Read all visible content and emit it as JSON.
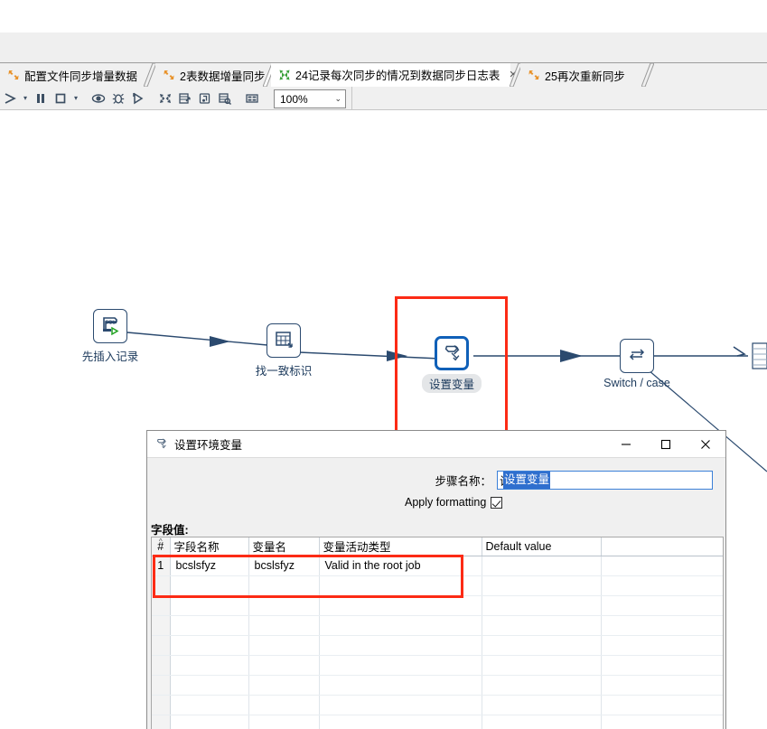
{
  "window": {
    "app_background": "#ffffff",
    "menu_band_color": "#efefef"
  },
  "tabs": [
    {
      "label": "配置文件同步增量数据",
      "icon": "job-sync-icon",
      "icon_color": "#e8922a",
      "active": false,
      "closable": false
    },
    {
      "label": "2表数据增量同步",
      "icon": "job-sync-icon",
      "icon_color": "#e8922a",
      "active": false,
      "closable": false
    },
    {
      "label": "24记录每次同步的情况到数据同步日志表",
      "icon": "transformation-icon",
      "icon_color": "#3aa03a",
      "active": true,
      "closable": true,
      "close_label": "✕"
    },
    {
      "label": "25再次重新同步",
      "icon": "job-sync-icon",
      "icon_color": "#e8922a",
      "active": false,
      "closable": false
    }
  ],
  "toolbar": {
    "buttons": [
      {
        "name": "run-icon",
        "title": "Run"
      },
      {
        "name": "run-dropdown-caret",
        "title": "Run options"
      },
      {
        "name": "pause-icon",
        "title": "Pause"
      },
      {
        "name": "stop-icon",
        "title": "Stop"
      },
      {
        "name": "stop-dropdown-caret",
        "title": "Stop options"
      },
      {
        "name": "preview-icon",
        "title": "Preview"
      },
      {
        "name": "debug-icon",
        "title": "Debug"
      },
      {
        "name": "replay-icon",
        "title": "Replay"
      },
      {
        "name": "transformation-icon",
        "title": "Transformation"
      },
      {
        "name": "metrics-icon",
        "title": "Metrics"
      },
      {
        "name": "sql-icon",
        "title": "SQL"
      },
      {
        "name": "inspect-icon",
        "title": "Inspect data"
      },
      {
        "name": "grid-icon",
        "title": "Arrange"
      }
    ],
    "zoom_value": "100%",
    "zoom_caret": "⌄"
  },
  "canvas": {
    "steps": [
      {
        "name": "step-insert-record",
        "label": "先插入记录",
        "icon": "table-output-sql-icon",
        "selected": false,
        "label_style": "plain"
      },
      {
        "name": "step-find-identity",
        "label": "找一致标识",
        "icon": "table-input-icon",
        "selected": false,
        "label_style": "plain"
      },
      {
        "name": "step-set-variables",
        "label": "设置变量",
        "icon": "set-variables-icon",
        "selected": true,
        "label_style": "pill"
      },
      {
        "name": "step-switch-case",
        "label": "Switch / case",
        "icon": "switch-case-icon",
        "selected": false,
        "label_style": "plain"
      }
    ],
    "selection_highlight_color": "#fc2b15"
  },
  "dialog": {
    "title": "设置环境变量",
    "title_icon": "set-variables-icon",
    "controls": {
      "minimize": "—",
      "maximize": "▢",
      "close": "✕"
    },
    "step_name_label": "步骤名称：",
    "step_name_value": "设置变量",
    "step_name_selected": true,
    "apply_formatting_label": "Apply formatting",
    "apply_formatting_checked": true,
    "field_values_label": "字段值:",
    "grid": {
      "headers": [
        "#",
        "字段名称",
        "变量名",
        "变量活动类型",
        "Default value",
        ""
      ],
      "sort_indicator": "^",
      "rows": [
        {
          "num": "1",
          "field_name": "bcslsfyz",
          "variable_name": "bcslsfyz",
          "variable_scope": "Valid in the root job",
          "default_value": "",
          "extra": ""
        }
      ],
      "empty_row_count": 8,
      "highlight_color": "#fc2b15"
    }
  }
}
